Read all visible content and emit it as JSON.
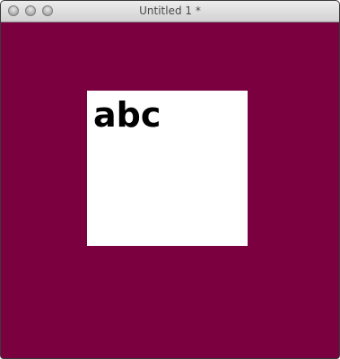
{
  "window": {
    "title": "Untitled 1 *"
  },
  "canvas": {
    "background_color": "#7a0040"
  },
  "card": {
    "text": "abc",
    "background_color": "#ffffff"
  },
  "icons": {
    "close": "close-button-icon",
    "minimize": "minimize-button-icon",
    "zoom": "zoom-button-icon"
  }
}
